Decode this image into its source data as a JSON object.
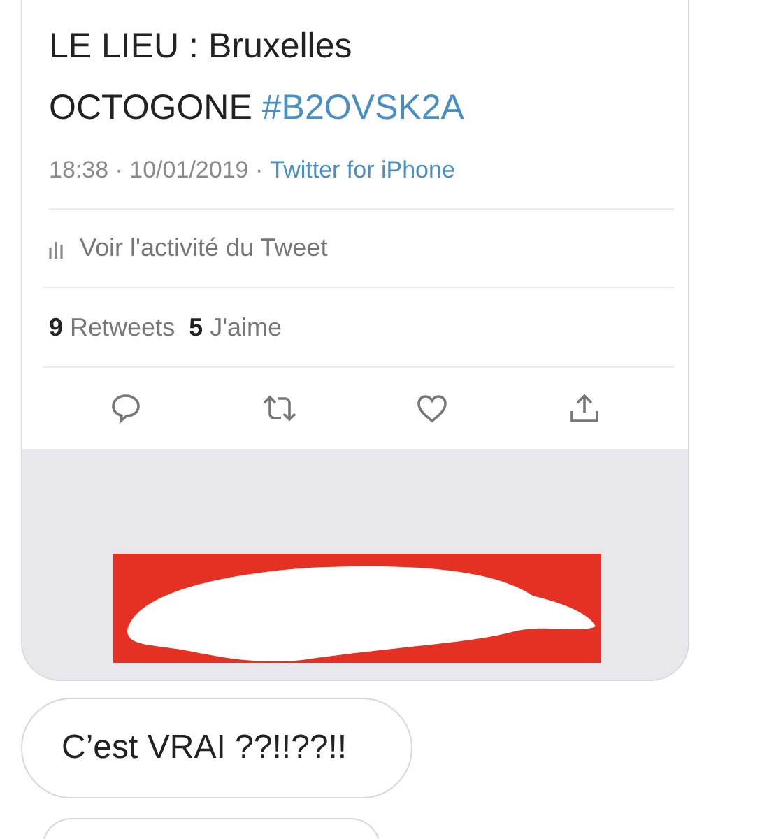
{
  "tweet": {
    "lines": [
      {
        "text": "LE LIEU : Bruxelles"
      },
      {
        "text": "OCTOGONE",
        "hashtag": "#B2OVSK2A"
      }
    ],
    "meta": "18:38 · 10/01/2019 ·",
    "source": "Twitter for iPhone",
    "activity_link": "Voir l'activité du Tweet",
    "stats": [
      {
        "count": "9",
        "label": "Retweets"
      },
      {
        "count": "5",
        "label": "J'aime"
      }
    ],
    "actions": [
      {
        "kind": "reply"
      },
      {
        "kind": "retweet"
      },
      {
        "kind": "like"
      },
      {
        "kind": "share"
      }
    ]
  },
  "messages": [
    {
      "text": "C’est VRAI ??!!??!!"
    }
  ]
}
